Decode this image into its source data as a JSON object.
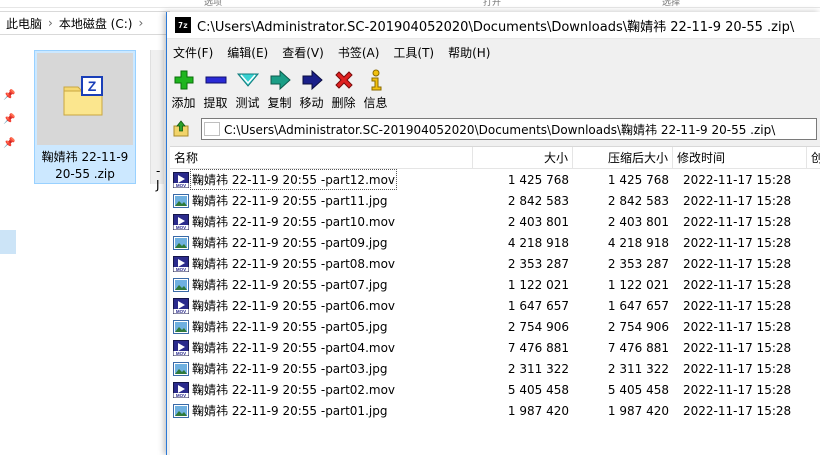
{
  "explorer": {
    "top_fragments": [
      "选项",
      "打开",
      "选择"
    ],
    "breadcrumb": [
      "此电脑",
      "本地磁盘 (C:)"
    ],
    "tile_name": "鞠婧祎 22-11-9 20-55 .zip",
    "tile_fragment": "-J"
  },
  "window": {
    "app_icon": "7z",
    "title": "C:\\Users\\Administrator.SC-201904052020\\Documents\\Downloads\\鞠婧祎 22-11-9 20-55 .zip\\",
    "menu": [
      "文件(F)",
      "编辑(E)",
      "查看(V)",
      "书签(A)",
      "工具(T)",
      "帮助(H)"
    ],
    "toolbar": [
      {
        "label": "添加",
        "icon": "add-icon"
      },
      {
        "label": "提取",
        "icon": "extract-icon"
      },
      {
        "label": "测试",
        "icon": "test-icon"
      },
      {
        "label": "复制",
        "icon": "copy-icon"
      },
      {
        "label": "移动",
        "icon": "move-icon"
      },
      {
        "label": "删除",
        "icon": "delete-icon"
      },
      {
        "label": "信息",
        "icon": "info-icon"
      }
    ],
    "path": "C:\\Users\\Administrator.SC-201904052020\\Documents\\Downloads\\鞠婧祎 22-11-9 20-55 .zip\\",
    "columns": {
      "name": "名称",
      "size": "大小",
      "packed": "压缩后大小",
      "modified": "修改时间",
      "extra": "创"
    },
    "files": [
      {
        "name": "鞠婧祎 22-11-9 20:55 -part12.mov",
        "type": "mov",
        "size": "1 425 768",
        "packed": "1 425 768",
        "modified": "2022-11-17 15:28"
      },
      {
        "name": "鞠婧祎 22-11-9 20:55 -part11.jpg",
        "type": "jpg",
        "size": "2 842 583",
        "packed": "2 842 583",
        "modified": "2022-11-17 15:28"
      },
      {
        "name": "鞠婧祎 22-11-9 20:55 -part10.mov",
        "type": "mov",
        "size": "2 403 801",
        "packed": "2 403 801",
        "modified": "2022-11-17 15:28"
      },
      {
        "name": "鞠婧祎 22-11-9 20:55 -part09.jpg",
        "type": "jpg",
        "size": "4 218 918",
        "packed": "4 218 918",
        "modified": "2022-11-17 15:28"
      },
      {
        "name": "鞠婧祎 22-11-9 20:55 -part08.mov",
        "type": "mov",
        "size": "2 353 287",
        "packed": "2 353 287",
        "modified": "2022-11-17 15:28"
      },
      {
        "name": "鞠婧祎 22-11-9 20:55 -part07.jpg",
        "type": "jpg",
        "size": "1 122 021",
        "packed": "1 122 021",
        "modified": "2022-11-17 15:28"
      },
      {
        "name": "鞠婧祎 22-11-9 20:55 -part06.mov",
        "type": "mov",
        "size": "1 647 657",
        "packed": "1 647 657",
        "modified": "2022-11-17 15:28"
      },
      {
        "name": "鞠婧祎 22-11-9 20:55 -part05.jpg",
        "type": "jpg",
        "size": "2 754 906",
        "packed": "2 754 906",
        "modified": "2022-11-17 15:28"
      },
      {
        "name": "鞠婧祎 22-11-9 20:55 -part04.mov",
        "type": "mov",
        "size": "7 476 881",
        "packed": "7 476 881",
        "modified": "2022-11-17 15:28"
      },
      {
        "name": "鞠婧祎 22-11-9 20:55 -part03.jpg",
        "type": "jpg",
        "size": "2 311 322",
        "packed": "2 311 322",
        "modified": "2022-11-17 15:28"
      },
      {
        "name": "鞠婧祎 22-11-9 20:55 -part02.mov",
        "type": "mov",
        "size": "5 405 458",
        "packed": "5 405 458",
        "modified": "2022-11-17 15:28"
      },
      {
        "name": "鞠婧祎 22-11-9 20:55 -part01.jpg",
        "type": "jpg",
        "size": "1 987 420",
        "packed": "1 987 420",
        "modified": "2022-11-17 15:28"
      }
    ]
  }
}
